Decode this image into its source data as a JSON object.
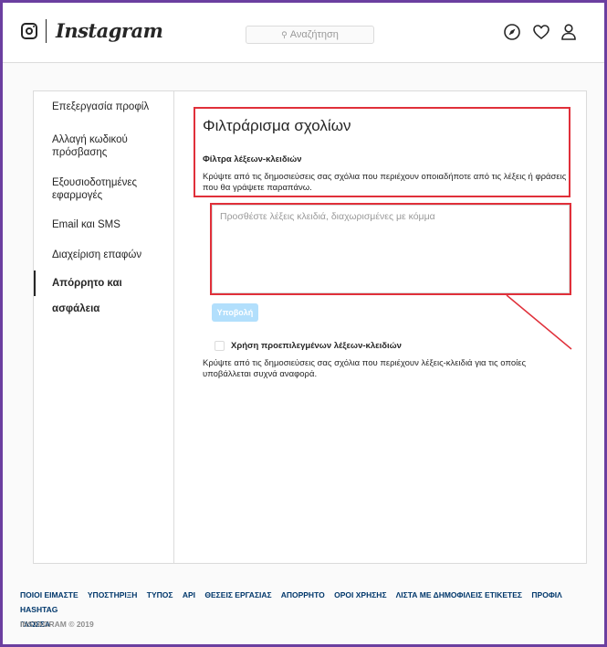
{
  "header": {
    "logo_text": "Instagram",
    "search_placeholder": "Αναζήτηση",
    "icons": [
      "instagram-camera-icon",
      "compass-icon",
      "heart-icon",
      "person-icon"
    ]
  },
  "sidebar": {
    "items": [
      {
        "label": "Επεξεργασία προφίλ"
      },
      {
        "label": "Αλλαγή κωδικού πρόσβασης"
      },
      {
        "label": "Εξουσιοδοτημένες εφαρμογές"
      },
      {
        "label": "Email και SMS"
      },
      {
        "label": "Διαχείριση επαφών"
      },
      {
        "label": "Απόρρητο και ασφάλεια"
      }
    ],
    "active_index": 5
  },
  "main": {
    "title": "Φιλτράρισμα σχολίων",
    "keyword_filter_heading": "Φίλτρα λέξεων-κλειδιών",
    "keyword_filter_desc": "Κρύψτε από τις δημοσιεύσεις σας σχόλια που περιέχουν οποιαδήποτε από τις λέξεις ή φράσεις που θα γράψετε παραπάνω.",
    "keyword_input_placeholder": "Προσθέστε λέξεις κλειδιά, διαχωρισμένες με κόμμα",
    "keyword_input_value": "",
    "submit_label": "Υποβολή",
    "default_keywords_label": "Χρήση προεπιλεγμένων λέξεων-κλειδιών",
    "default_keywords_checked": false,
    "default_keywords_desc": "Κρύψτε από τις δημοσιεύσεις σας σχόλια που περιέχουν λέξεις-κλειδιά για τις οποίες υποβάλλεται συχνά αναφορά."
  },
  "footer": {
    "links": [
      "ΠΟΙΟΙ ΕΙΜΑΣΤΕ",
      "ΥΠΟΣΤΗΡΙΞΗ",
      "ΤΥΠΟΣ",
      "API",
      "ΘΕΣΕΙΣ ΕΡΓΑΣΙΑΣ",
      "ΑΠΟΡΡΗΤΟ",
      "ΟΡΟΙ ΧΡΗΣΗΣ",
      "ΛΙΣΤΑ ΜΕ ΔΗΜΟΦΙΛΕΙΣ ΕΤΙΚΕΤΕΣ",
      "ΠΡΟΦΙΛ",
      "HASHTAG",
      "ΓΛΩΣΣΑ"
    ],
    "copyright": "INSTAGRAM © 2019"
  },
  "colors": {
    "annotation_red": "#e0303a",
    "frame_purple": "#6b3fa0",
    "submit_disabled": "#b2dffc",
    "link_blue": "#00376b"
  }
}
